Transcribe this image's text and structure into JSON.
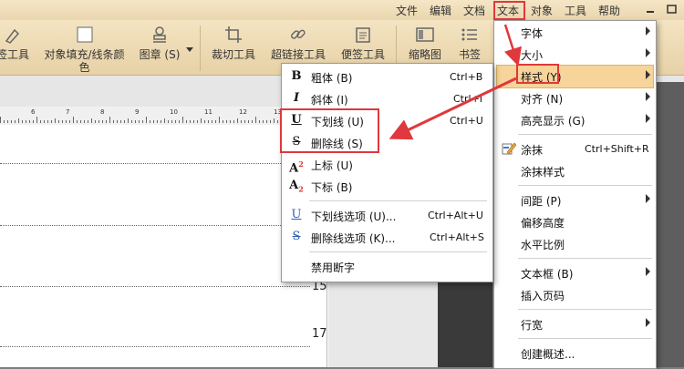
{
  "menubar": {
    "items": [
      "文件",
      "编辑",
      "文档",
      "文本",
      "对象",
      "工具",
      "帮助"
    ],
    "active": "文本"
  },
  "ribbon": {
    "tools": [
      {
        "label": "签工具"
      },
      {
        "label": "对象填充/线条颜\n色"
      },
      {
        "label": "图章 (S)"
      },
      {
        "label": "裁切工具"
      },
      {
        "label": "超链接工具"
      },
      {
        "label": "便签工具"
      },
      {
        "label": "缩略图"
      },
      {
        "label": "书签"
      }
    ]
  },
  "ruler": {
    "numbers": [
      "6",
      "7",
      "8",
      "9",
      "10",
      "11",
      "12",
      "13"
    ]
  },
  "page": {
    "numbers": [
      "15",
      "17"
    ]
  },
  "text_menu": {
    "items": [
      {
        "label": "字体",
        "submenu": true
      },
      {
        "label": "大小",
        "submenu": true
      },
      {
        "label": "样式 (Y)",
        "submenu": true,
        "highlighted": true
      },
      {
        "label": "对齐 (N)",
        "submenu": true
      },
      {
        "label": "高亮显示 (G)",
        "submenu": true
      },
      {
        "label": "涂抹",
        "shortcut": "Ctrl+Shift+R"
      },
      {
        "label": "涂抹样式"
      },
      {
        "label": "间距 (P)",
        "submenu": true
      },
      {
        "label": "偏移高度"
      },
      {
        "label": "水平比例"
      },
      {
        "label": "文本框 (B)",
        "submenu": true
      },
      {
        "label": "插入页码"
      },
      {
        "label": "行宽",
        "submenu": true
      },
      {
        "label": "创建概述..."
      }
    ]
  },
  "style_submenu": {
    "items": [
      {
        "label": "粗体 (B)",
        "shortcut": "Ctrl+B",
        "icon": "B"
      },
      {
        "label": "斜体 (I)",
        "shortcut": "Ctrl+I",
        "icon": "I"
      },
      {
        "label": "下划线 (U)",
        "shortcut": "Ctrl+U",
        "icon": "U"
      },
      {
        "label": "删除线 (S)",
        "shortcut": "",
        "icon": "S"
      },
      {
        "label": "上标 (U)",
        "shortcut": "",
        "icon": "A"
      },
      {
        "label": "下标 (B)",
        "shortcut": "",
        "icon": "A"
      },
      {
        "label": "下划线选项 (U)...",
        "shortcut": "Ctrl+Alt+U",
        "icon": "U"
      },
      {
        "label": "删除线选项 (K)...",
        "shortcut": "Ctrl+Alt+S",
        "icon": "S"
      },
      {
        "label": "禁用断字",
        "shortcut": "",
        "icon": ""
      }
    ]
  },
  "superscript_mark": "2",
  "subscript_mark": "2",
  "colors": {
    "highlight": "#f6d49a",
    "annotation": "#e0383c",
    "ribbon": "#f0deb8"
  }
}
